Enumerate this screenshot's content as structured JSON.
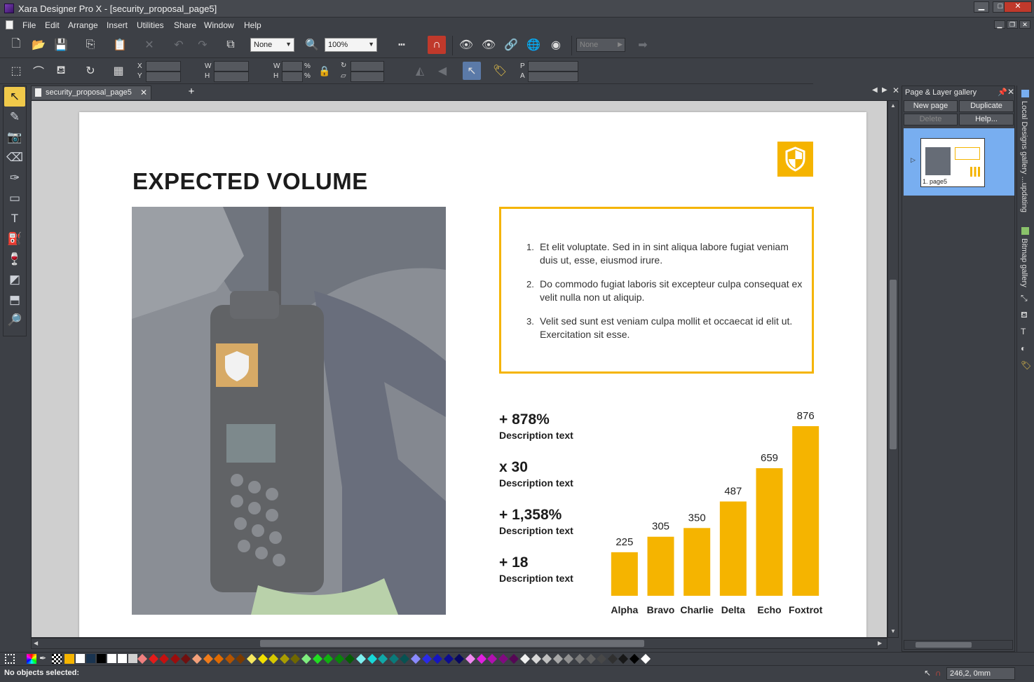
{
  "window": {
    "app_name": "Xara Designer Pro X",
    "title": "Xara Designer Pro X - [security_proposal_page5]",
    "minimize": "▁",
    "maximize": "□",
    "close": "✕"
  },
  "menu": [
    "File",
    "Edit",
    "Arrange",
    "Insert",
    "Utilities",
    "Share",
    "Window",
    "Help"
  ],
  "toolbar": {
    "quality_value": "None",
    "zoom_value": "100%",
    "color_none_value": "None"
  },
  "infobar": {
    "x_label": "X",
    "y_label": "Y",
    "w_label": "W",
    "h_label": "H",
    "w2_label": "W",
    "h2_label": "H",
    "pct1": "%",
    "pct2": "%",
    "p_label": "P",
    "a_label": "A"
  },
  "tab": {
    "document_name": "security_proposal_page5",
    "close": "✕",
    "add": "+"
  },
  "page": {
    "title": "EXPECTED VOLUME",
    "list": [
      {
        "num": "1.",
        "text": "Et elit voluptate. Sed in in sint aliqua labore fugiat veniam duis ut, esse, eiusmod irure."
      },
      {
        "num": "2.",
        "text": "Do commodo fugiat laboris sit excepteur culpa consequat ex velit nulla non ut aliquip."
      },
      {
        "num": "3.",
        "text": "Velit sed sunt est veniam culpa mollit et occaecat id elit ut. Exercitation sit esse."
      }
    ],
    "stats": [
      {
        "value": "+ 878%",
        "desc": "Description text"
      },
      {
        "value": "x 30",
        "desc": "Description text"
      },
      {
        "value": "+ 1,358%",
        "desc": "Description text"
      },
      {
        "value": "+ 18",
        "desc": "Description text"
      }
    ],
    "accent_color": "#f5b400"
  },
  "chart_data": {
    "type": "bar",
    "categories": [
      "Alpha",
      "Bravo",
      "Charlie",
      "Delta",
      "Echo",
      "Foxtrot"
    ],
    "values": [
      225,
      305,
      350,
      487,
      659,
      876
    ],
    "ylim": [
      0,
      876
    ],
    "grid": false,
    "color": "#f5b400"
  },
  "gallery": {
    "title": "Page & Layer gallery",
    "new_page": "New page",
    "duplicate": "Duplicate",
    "delete": "Delete",
    "help": "Help...",
    "thumb_label": "1. page5",
    "side_local": "Local Designs gallery ...updating",
    "side_bitmap": "Bitmap gallery"
  },
  "status": {
    "message": "No objects selected:",
    "coords": "246,2, 0mm"
  },
  "palette": [
    "#ffffff",
    "#1a3450",
    "#000000",
    "#ffffff",
    "#ffffff",
    "#d0d0d0",
    "#f08080",
    "#e31b1b",
    "#c41010",
    "#9b0d0d",
    "#701010",
    "#f4a07a",
    "#f07b1a",
    "#e06a00",
    "#b35400",
    "#7a3a00",
    "#f7e860",
    "#f2e000",
    "#d6c800",
    "#a89c00",
    "#6f6700",
    "#7fee7f",
    "#22dd22",
    "#10b010",
    "#0a850a",
    "#075c07",
    "#7ff0f0",
    "#18d8d8",
    "#10a8a8",
    "#0a7a7a",
    "#075252",
    "#8a8aff",
    "#2a2ae8",
    "#1515c0",
    "#0d0d90",
    "#080860",
    "#f08af0",
    "#e020e0",
    "#b010b0",
    "#800a80",
    "#550755",
    "#f0f0f0",
    "#d8d8d8",
    "#c0c0c0",
    "#a8a8a8",
    "#909090",
    "#787878",
    "#606060",
    "#484848",
    "#303030",
    "#181818",
    "#000000",
    "#ffffff"
  ]
}
